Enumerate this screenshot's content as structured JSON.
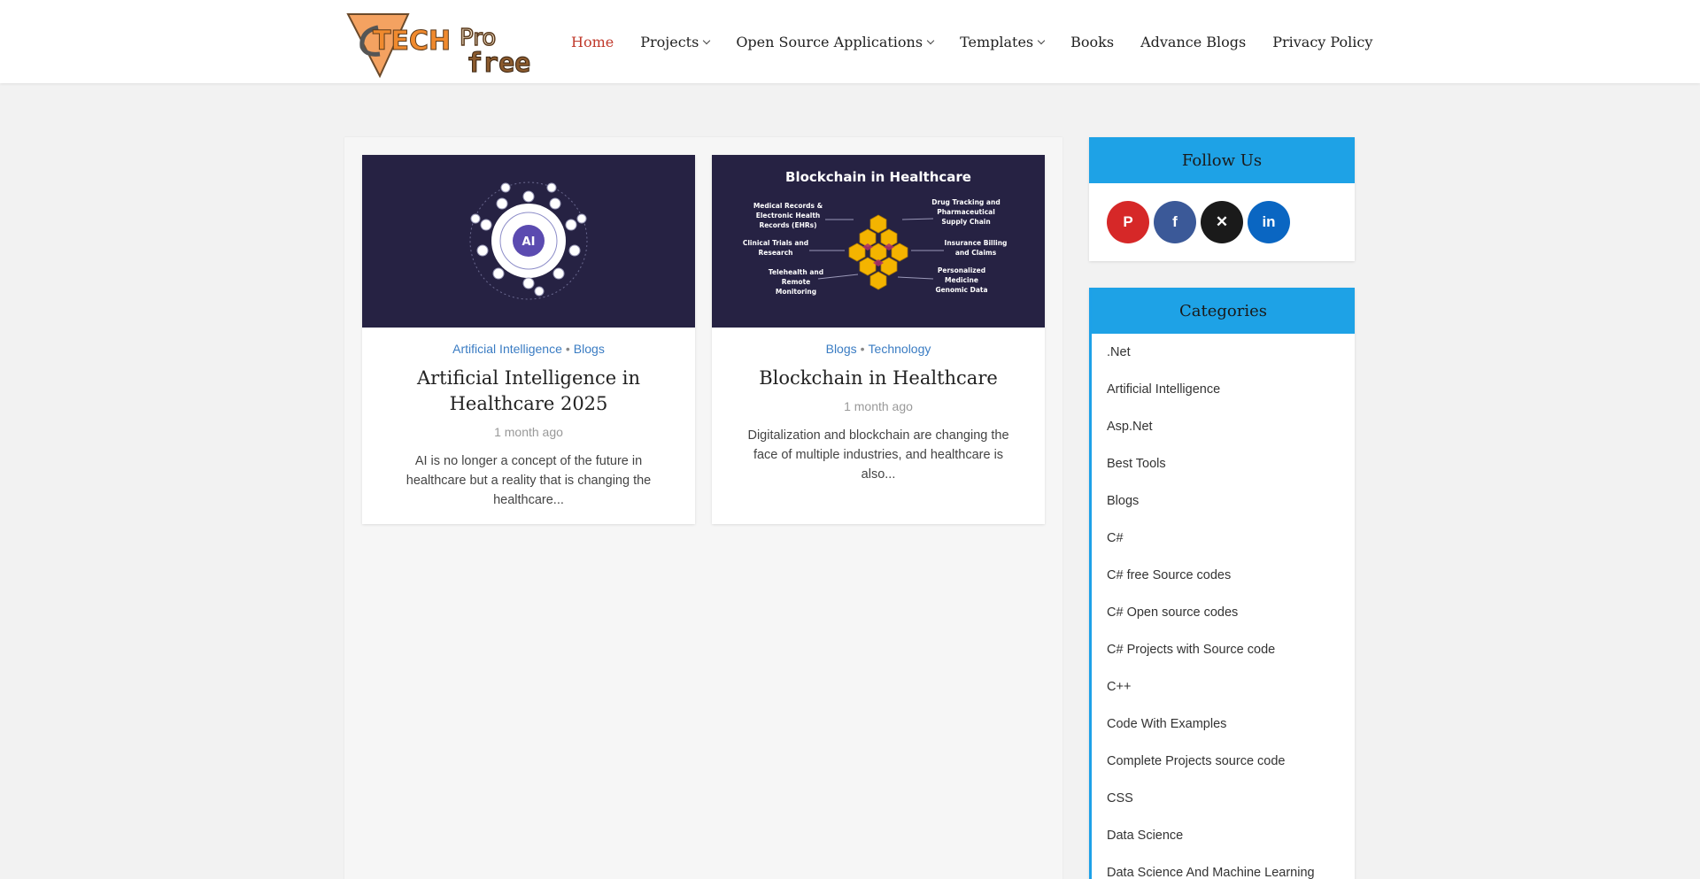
{
  "brand": {
    "logo_text": "TECHPro free"
  },
  "nav": {
    "items": [
      {
        "label": "Home"
      },
      {
        "label": "Projects"
      },
      {
        "label": "Open Source Applications"
      },
      {
        "label": "Templates"
      },
      {
        "label": "Books"
      },
      {
        "label": "Advance Blogs"
      },
      {
        "label": "Privacy Policy"
      }
    ]
  },
  "posts": [
    {
      "categories": [
        "Artificial Intelligence",
        "Blogs"
      ],
      "title": "Artificial Intelligence in Healthcare 2025",
      "date": "1 month ago",
      "excerpt": "AI is no longer a concept of the future in healthcare but a reality that is changing the healthcare...",
      "image_center_text": "AI"
    },
    {
      "categories": [
        "Blogs",
        "Technology"
      ],
      "title": "Blockchain in Healthcare",
      "date": "1 month ago",
      "excerpt": "Digitalization and blockchain are changing the face of multiple industries, and healthcare is also...",
      "image": {
        "heading": "Blockchain in Healthcare",
        "left_labels": [
          "Medical Records &",
          "Electronic Health",
          "Records (EHRs)",
          "Clinical Trials and",
          "Research",
          "Telehealth and",
          "Remote",
          "Monitoring"
        ],
        "right_labels": [
          "Drug Tracking and",
          "Pharmaceutical",
          "Supply Chain",
          "Insurance Billing",
          "and Claims",
          "Personalized",
          "Medicine",
          "Genomic Data"
        ]
      }
    }
  ],
  "follow": {
    "title": "Follow Us",
    "networks": [
      {
        "icon": "pinterest-icon",
        "glyph": "P"
      },
      {
        "icon": "facebook-icon",
        "glyph": "f"
      },
      {
        "icon": "x-icon",
        "glyph": "✕"
      },
      {
        "icon": "linkedin-icon",
        "glyph": "in"
      }
    ]
  },
  "categories_widget": {
    "title": "Categories",
    "items": [
      ".Net",
      "Artificial Intelligence",
      "Asp.Net",
      "Best Tools",
      "Blogs",
      "C#",
      "C# free Source codes",
      "C# Open source codes",
      "C# Projects with Source code",
      "C++",
      "Code With Examples",
      "Complete Projects source code",
      "CSS",
      "Data Science",
      "Data Science And Machine Learning"
    ]
  },
  "colors": {
    "accent": "#1ea2e6",
    "active_nav": "#c0392b",
    "category_link": "#3a7cc3",
    "thumb_bg": "#262243"
  }
}
